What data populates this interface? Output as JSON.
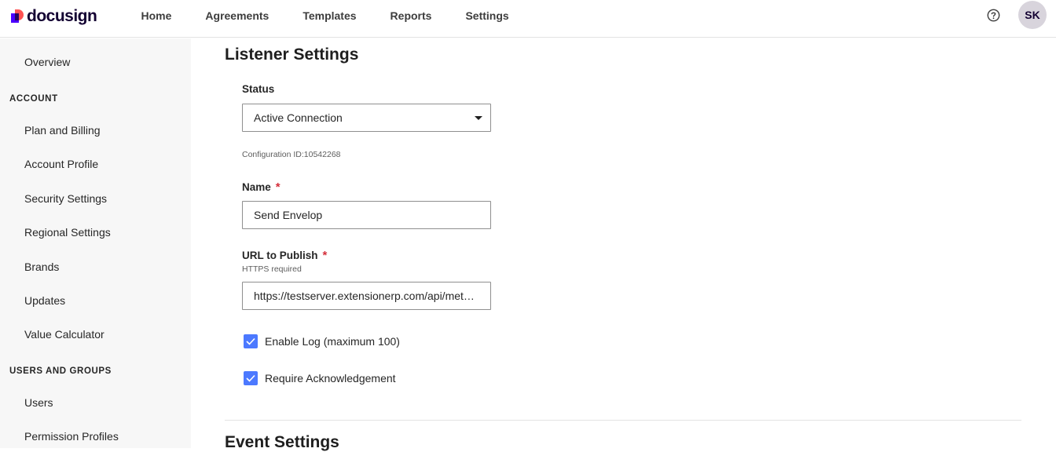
{
  "brand": {
    "name": "docusign"
  },
  "nav": {
    "items": [
      {
        "label": "Home"
      },
      {
        "label": "Agreements"
      },
      {
        "label": "Templates"
      },
      {
        "label": "Reports"
      },
      {
        "label": "Settings"
      }
    ],
    "help_icon": "help-circle-icon",
    "avatar_initials": "SK"
  },
  "sidebar": {
    "overview": "Overview",
    "account_heading": "ACCOUNT",
    "account_items": [
      "Plan and Billing",
      "Account Profile",
      "Security Settings",
      "Regional Settings",
      "Brands",
      "Updates",
      "Value Calculator"
    ],
    "users_heading": "USERS AND GROUPS",
    "users_items": [
      "Users",
      "Permission Profiles"
    ]
  },
  "main": {
    "title": "Listener Settings",
    "status": {
      "label": "Status",
      "value": "Active Connection"
    },
    "config_id": "Configuration ID:10542268",
    "name": {
      "label": "Name",
      "required": "*",
      "value": "Send Envelop"
    },
    "url": {
      "label": "URL to Publish",
      "required": "*",
      "hint": "HTTPS required",
      "value": "https://testserver.extensionerp.com/api/method/esign_app.api.get_status"
    },
    "checkboxes": [
      {
        "label": "Enable Log (maximum 100)",
        "checked": true
      },
      {
        "label": "Require Acknowledgement",
        "checked": true
      }
    ],
    "next_section": "Event Settings"
  },
  "colors": {
    "accent": "#4c79ff",
    "brand_purple": "#4c00ff",
    "brand_coral": "#ff5252",
    "required": "#d42f3b",
    "sidebar_bg": "#f7f7f7"
  }
}
